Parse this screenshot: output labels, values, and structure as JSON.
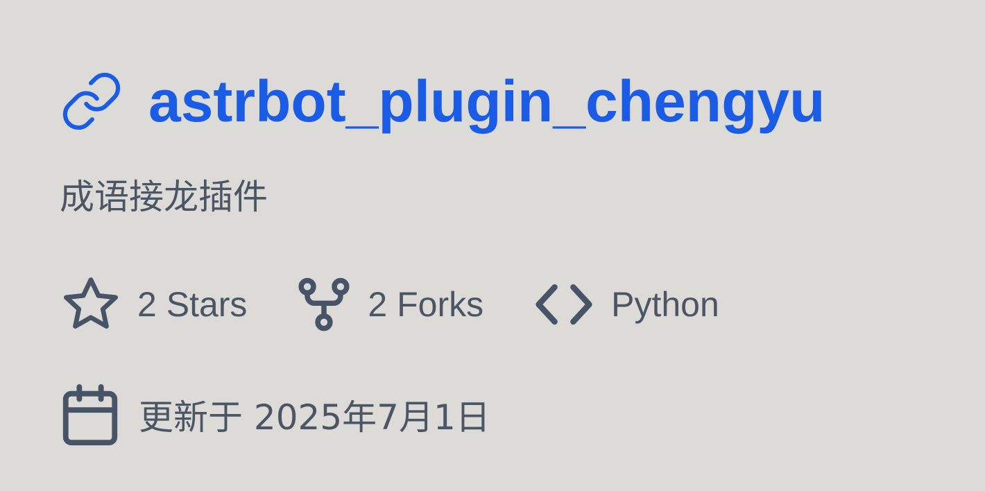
{
  "repo": {
    "name": "astrbot_plugin_chengyu",
    "description": "成语接龙插件",
    "link_icon": "link-icon",
    "accent_color": "#1b5ce6",
    "text_color": "#4b5563"
  },
  "stats": {
    "stars_label": "2 Stars",
    "stars_icon": "star-icon",
    "forks_label": "2 Forks",
    "forks_icon": "fork-icon",
    "language_label": "Python",
    "language_icon": "code-icon"
  },
  "updated": {
    "label": "更新于 2025年7月1日",
    "icon": "calendar-icon"
  }
}
